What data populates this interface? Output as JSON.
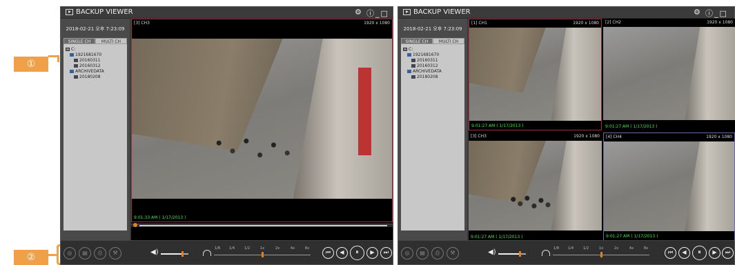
{
  "callouts": {
    "one": "①",
    "two": "②"
  },
  "viewers": [
    {
      "title": "BACKUP VIEWER",
      "gear": "⚙",
      "controls": {
        "info": "ⓘ",
        "minimize": "_",
        "maximize": "□",
        "close": "✕"
      },
      "datetime": "2018-02-21 오후 7:23:09",
      "tabs": {
        "single": "SINGLE CH",
        "multi": "MULTI CH"
      },
      "tree": [
        "C:",
        "1921681670",
        "20160311",
        "20160312",
        "ARCHIVEDATA",
        "20180208"
      ],
      "layouts": [
        "1",
        "4",
        "9",
        "16"
      ],
      "cams": [
        {
          "ch": "[3] CH3",
          "res": "1920 x 1080",
          "ts": "9:01:33 AM ( 1/17/2013 )"
        }
      ]
    },
    {
      "title": "BACKUP VIEWER",
      "gear": "⚙",
      "controls": {
        "info": "ⓘ",
        "minimize": "_",
        "maximize": "□",
        "close": "✕"
      },
      "datetime": "2018-02-21 오후 7:23:09",
      "tabs": {
        "single": "SINGLE CH",
        "multi": "MULTI CH"
      },
      "tree": [
        "C:",
        "1921681670",
        "20160311",
        "20160312",
        "ARCHIVEDATA",
        "20180208"
      ],
      "layouts": [
        "1",
        "4",
        "9",
        "16"
      ],
      "cams": [
        {
          "ch": "[1] CH1",
          "res": "1920 x 1080",
          "ts": "9:01:27 AM ( 1/17/2013 )"
        },
        {
          "ch": "[2] CH2",
          "res": "1920 x 1080",
          "ts": "9:01:27 AM ( 1/17/2013 )"
        },
        {
          "ch": "[3] CH3",
          "res": "1920 x 1080",
          "ts": "9:01:27 AM ( 1/17/2013 )"
        },
        {
          "ch": "[4] CH4",
          "res": "1920 x 1080",
          "ts": "9:01:27 AM ( 1/17/2013 )"
        }
      ]
    }
  ],
  "speed_ticks": [
    "1/8",
    "1/4",
    "1/2",
    "1x",
    "2x",
    "4x",
    "8x"
  ],
  "playback": {
    "prev": "⏮",
    "rew": "◀",
    "pause": "⏸",
    "play": "▶",
    "next": "⏭"
  },
  "colors": {
    "accent": "#e6801e",
    "callout": "#f0a048",
    "timestamp": "#49e04a"
  }
}
